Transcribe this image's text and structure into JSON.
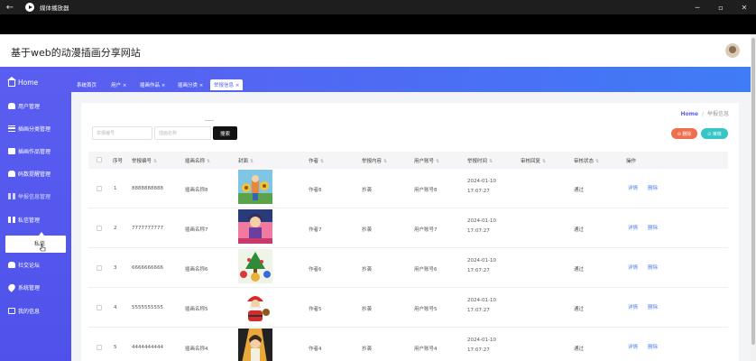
{
  "window": {
    "title": "媒体播放器",
    "back_icon": "back-arrow-icon",
    "controls": [
      "minimize-icon",
      "maximize-icon",
      "close-icon"
    ]
  },
  "header": {
    "site_title": "基于web的动漫插画分享网站"
  },
  "sidebar": {
    "items": [
      {
        "label": "Home",
        "icon": "home-icon"
      },
      {
        "label": "用户管理",
        "icon": "user-icon"
      },
      {
        "label": "插画分类管理",
        "icon": "list-icon"
      },
      {
        "label": "插画作品管理",
        "icon": "image-icon"
      },
      {
        "label": "码数提醒管理",
        "icon": "user-icon"
      },
      {
        "label": "举报信息管理",
        "icon": "grid-icon"
      },
      {
        "label": "私信管理",
        "icon": "grid-icon"
      },
      {
        "label": "私信",
        "icon": ""
      },
      {
        "label": "社交论坛",
        "icon": "user-icon"
      },
      {
        "label": "系统管理",
        "icon": "pin-icon"
      },
      {
        "label": "我的信息",
        "icon": "doc-icon"
      }
    ]
  },
  "tabs": [
    {
      "label": "系统首页"
    },
    {
      "label": "用户 ×"
    },
    {
      "label": "插画作品 ×"
    },
    {
      "label": "插画分类 ×"
    },
    {
      "label": "举报信息 ×"
    }
  ],
  "breadcrumb": {
    "home": "Home",
    "separator": "/",
    "current": "举报信息"
  },
  "search": {
    "placeholder1": "举报编号",
    "placeholder2": "插画名称",
    "button": "搜索"
  },
  "actions": {
    "delete": "⊖ 删除",
    "audit": "⊙ 审核"
  },
  "table": {
    "headers": [
      "序号",
      "举报编号",
      "插画名称",
      "封面",
      "作者",
      "举报内容",
      "用户账号",
      "举报时间",
      "审核回复",
      "审核状态",
      "操作"
    ],
    "rows": [
      {
        "index": "1",
        "code": "8888888888",
        "name": "插画名称8",
        "author": "作者8",
        "content": "抄袭",
        "account": "用户账号8",
        "time": "2024-01-10 17:07:27",
        "reply": "",
        "status": "通过",
        "detail": "详情",
        "del": "删除"
      },
      {
        "index": "2",
        "code": "7777777777",
        "name": "插画名称7",
        "author": "作者7",
        "content": "抄袭",
        "account": "用户账号7",
        "time": "2024-01-10 17:07:27",
        "reply": "",
        "status": "通过",
        "detail": "详情",
        "del": "删除"
      },
      {
        "index": "3",
        "code": "6666666666",
        "name": "插画名称6",
        "author": "作者6",
        "content": "抄袭",
        "account": "用户账号6",
        "time": "2024-01-10 17:07:27",
        "reply": "",
        "status": "通过",
        "detail": "详情",
        "del": "删除"
      },
      {
        "index": "4",
        "code": "5555555555",
        "name": "插画名称5",
        "author": "作者5",
        "content": "抄袭",
        "account": "用户账号5",
        "time": "2024-01-10 17:07:27",
        "reply": "",
        "status": "通过",
        "detail": "详情",
        "del": "删除"
      },
      {
        "index": "5",
        "code": "4444444444",
        "name": "插画名称4",
        "author": "作者4",
        "content": "抄袭",
        "account": "用户账号4",
        "time": "2024-01-10 17:07:27",
        "reply": "",
        "status": "通过",
        "detail": "详情",
        "del": "删除"
      }
    ]
  },
  "colors": {
    "sidebar": "#5a5ef0",
    "accent": "#5b5ef0",
    "delete": "#ef6e4e",
    "audit": "#36c6c6",
    "search_button": "#111111",
    "link": "#4a7cf0"
  }
}
